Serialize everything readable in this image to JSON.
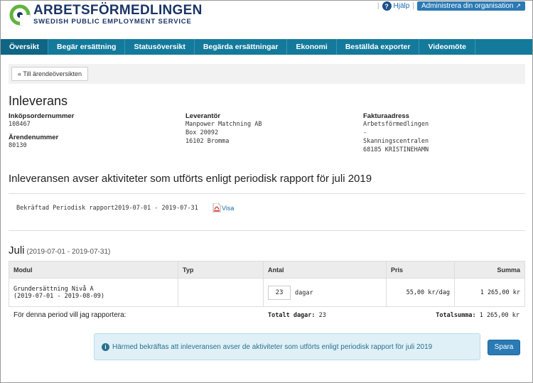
{
  "brand": {
    "name": "ARBETSFÖRMEDLINGEN",
    "subtitle": "SWEDISH PUBLIC EMPLOYMENT SERVICE",
    "color": "#1a3566"
  },
  "top_links": {
    "help": "Hjälp",
    "admin": "Administrera din organisation"
  },
  "nav": {
    "items": [
      "Översikt",
      "Begär ersättning",
      "Statusöversikt",
      "Begärda ersättningar",
      "Ekonomi",
      "Beställda exporter",
      "Videomöte"
    ],
    "active_index": 0,
    "color": "#137a9b"
  },
  "back_button": "« Till ärendeöversikten",
  "page_title": "Inleverans",
  "order": {
    "po_label": "Inköpsordernummer",
    "po_value": "108467",
    "case_label": "Ärendenummer",
    "case_value": "80130"
  },
  "supplier": {
    "label": "Leverantör",
    "lines": [
      "Manpower Matchning AB",
      "Box 20092",
      "16102 Bromma"
    ]
  },
  "invoice": {
    "label": "Fakturaadress",
    "lines": [
      "Arbetsförmedlingen",
      "-",
      "Skanningscentralen",
      "68185 KRISTINEHAMN"
    ]
  },
  "section_title": "Inleveransen avser aktiviteter som utförts enligt periodisk rapport för juli 2019",
  "report": {
    "name": "Bekräftad Periodisk rapport",
    "period": "2019-07-01 - 2019-07-31",
    "link": "Visa"
  },
  "month": {
    "title": "Juli",
    "range": "(2019-07-01 - 2019-07-31)"
  },
  "table": {
    "headers": [
      "Modul",
      "Typ",
      "Antal",
      "Pris",
      "Summa"
    ],
    "row": {
      "module": "Grundersättning Nivå A",
      "module_period": "(2019-07-01 - 2019-08-09)",
      "type": "",
      "quantity": "23",
      "unit": "dagar",
      "price": "55,00 kr/dag",
      "sum": "1 265,00 kr"
    }
  },
  "summary": {
    "label": "För denna period vill jag rapportera:",
    "days_label": "Totalt dagar:",
    "days_value": "23",
    "total_label": "Totalsumma:",
    "total_value": "1 265,00 kr"
  },
  "confirm_text": "Härmed bekräftas att inleveransen avser de aktiviteter som utförts enligt periodisk rapport för juli 2019",
  "save_button": "Spara"
}
